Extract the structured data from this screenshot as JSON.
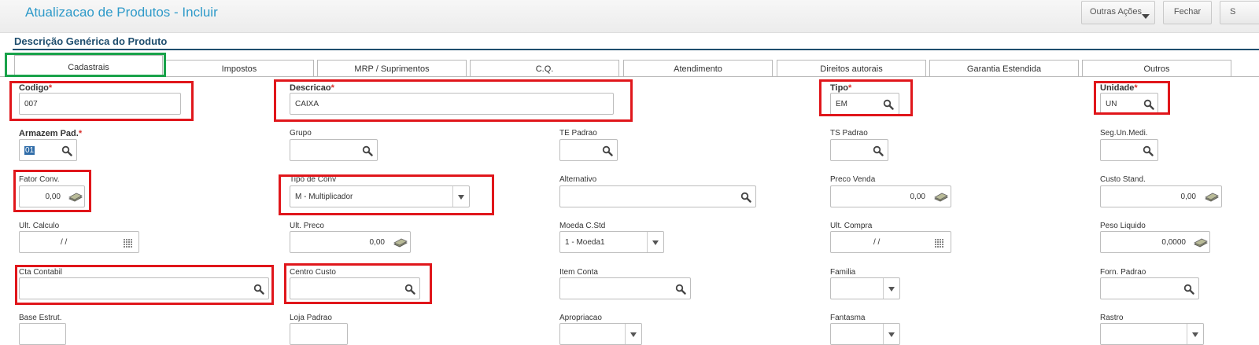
{
  "header": {
    "title": "Atualizacao de Produtos - Incluir",
    "other_actions": "Outras Ações",
    "close": "Fechar",
    "save": "S"
  },
  "section_title": "Descrição Genérica do Produto",
  "tabs": [
    "Cadastrais",
    "Impostos",
    "MRP / Suprimentos",
    "C.Q.",
    "Atendimento",
    "Direitos autorais",
    "Garantia Estendida",
    "Outros"
  ],
  "fields": {
    "codigo": {
      "label": "Codigo",
      "value": "007"
    },
    "descricao": {
      "label": "Descricao",
      "value": "CAIXA"
    },
    "tipo": {
      "label": "Tipo",
      "value": "EM"
    },
    "unidade": {
      "label": "Unidade",
      "value": "UN"
    },
    "armazem": {
      "label": "Armazem Pad.",
      "value": "01"
    },
    "grupo": {
      "label": "Grupo",
      "value": ""
    },
    "te_padrao": {
      "label": "TE Padrao",
      "value": ""
    },
    "ts_padrao": {
      "label": "TS Padrao",
      "value": ""
    },
    "seg_un": {
      "label": "Seg.Un.Medi.",
      "value": ""
    },
    "fator_conv": {
      "label": "Fator Conv.",
      "value": "0,00"
    },
    "tipo_conv": {
      "label": "Tipo de Conv",
      "value": "M - Multiplicador"
    },
    "alternativo": {
      "label": "Alternativo",
      "value": ""
    },
    "preco_venda": {
      "label": "Preco Venda",
      "value": "0,00"
    },
    "custo_stand": {
      "label": "Custo Stand.",
      "value": "0,00"
    },
    "ult_calculo": {
      "label": "Ult. Calculo",
      "value": "/ /"
    },
    "ult_preco": {
      "label": "Ult. Preco",
      "value": "0,00"
    },
    "moeda": {
      "label": "Moeda C.Std",
      "value": "1 - Moeda1"
    },
    "ult_compra": {
      "label": "Ult. Compra",
      "value": "/ /"
    },
    "peso_liquido": {
      "label": "Peso Liquido",
      "value": "0,0000"
    },
    "cta_contabil": {
      "label": "Cta Contabil",
      "value": ""
    },
    "centro_custo": {
      "label": "Centro Custo",
      "value": ""
    },
    "item_conta": {
      "label": "Item Conta",
      "value": ""
    },
    "familia": {
      "label": "Familia",
      "value": ""
    },
    "forn_padrao": {
      "label": "Forn. Padrao",
      "value": ""
    },
    "base_estrut": {
      "label": "Base Estrut.",
      "value": ""
    },
    "loja_padrao": {
      "label": "Loja Padrao",
      "value": ""
    },
    "apropriacao": {
      "label": "Apropriacao",
      "value": ""
    },
    "fantasma": {
      "label": "Fantasma",
      "value": ""
    },
    "rastro": {
      "label": "Rastro",
      "value": ""
    }
  },
  "required_mark": "*",
  "colors": {
    "title": "#2e9ac9",
    "section": "#1f4e6e",
    "highlight_red": "#e0161b",
    "highlight_green": "#19a24a",
    "required": "#d9302c"
  },
  "icons": {
    "lookup": "search-icon",
    "calculator": "calculator-icon",
    "calendar": "calendar-icon",
    "dropdown": "chevron-down-icon"
  }
}
